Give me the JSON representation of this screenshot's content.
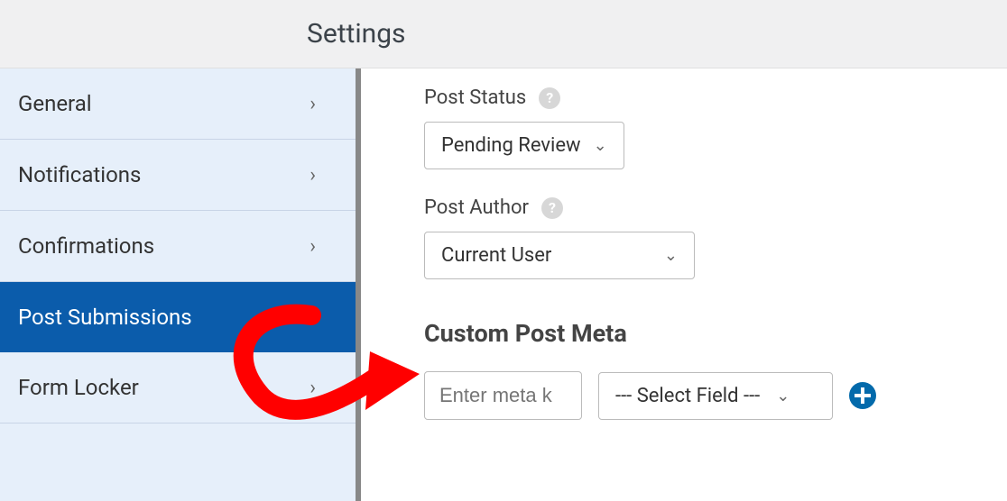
{
  "header": {
    "title": "Settings"
  },
  "sidebar": {
    "items": [
      {
        "label": "General"
      },
      {
        "label": "Notifications"
      },
      {
        "label": "Confirmations"
      },
      {
        "label": "Post Submissions"
      },
      {
        "label": "Form Locker"
      }
    ]
  },
  "main": {
    "post_status": {
      "label": "Post Status",
      "value": "Pending Review"
    },
    "post_author": {
      "label": "Post Author",
      "value": "Current User"
    },
    "custom_meta": {
      "title": "Custom Post Meta",
      "key_placeholder": "Enter meta k",
      "field_placeholder": "--- Select Field ---"
    }
  }
}
